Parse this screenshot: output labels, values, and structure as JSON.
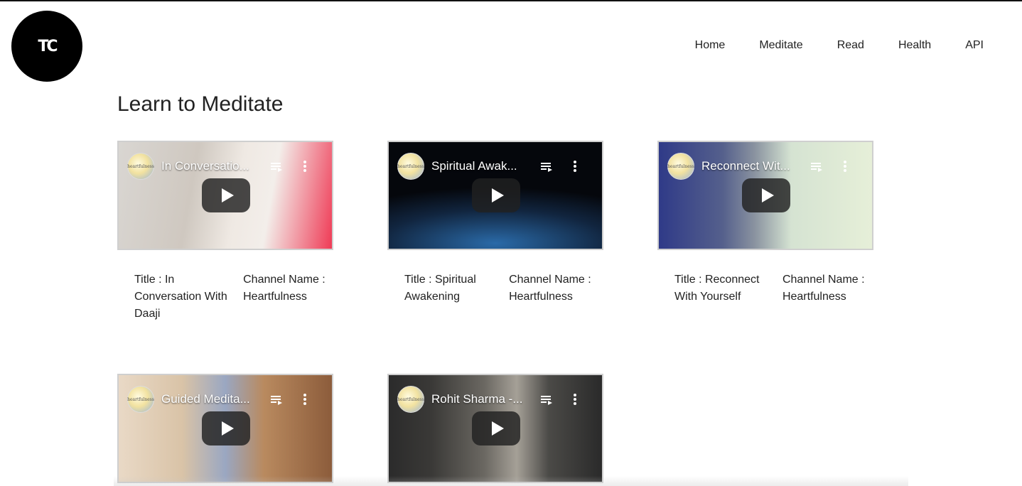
{
  "logo": {
    "text": "TC"
  },
  "nav": {
    "items": [
      "Home",
      "Meditate",
      "Read",
      "Health",
      "API"
    ]
  },
  "page": {
    "title": "Learn to Meditate"
  },
  "videos": [
    {
      "overlay_title": "In Conversatio...",
      "title_text": "Title : In Conversation With Daaji",
      "channel_text": "Channel Name : Heartfulness",
      "channel_logo": "heartfulness",
      "thumb_colors": [
        "#d9d6d2",
        "#e8e4e0",
        "#ef3b56"
      ]
    },
    {
      "overlay_title": "Spiritual Awak...",
      "title_text": "Title : Spiritual Awakening",
      "channel_text": "Channel Name : Heartfulness",
      "channel_logo": "heartfulness",
      "thumb_colors": [
        "#05070c",
        "#11253f",
        "#2a6aa8"
      ]
    },
    {
      "overlay_title": "Reconnect Wit...",
      "title_text": "Title : Reconnect With Yourself",
      "channel_text": "Channel Name : Heartfulness",
      "channel_logo": "heartfulness",
      "thumb_colors": [
        "#2f3a88",
        "#6b7a9a",
        "#e6efd8"
      ]
    },
    {
      "overlay_title": "Guided Medita...",
      "title_text": "",
      "channel_text": "",
      "channel_logo": "heartfulness",
      "thumb_colors": [
        "#8c5c3b",
        "#c9a27c",
        "#e9d9c6"
      ]
    },
    {
      "overlay_title": "Rohit Sharma -...",
      "title_text": "",
      "channel_text": "",
      "channel_logo": "heartfulness",
      "thumb_colors": [
        "#2b2b2b",
        "#6b6862",
        "#a5a097"
      ]
    }
  ],
  "colors": {
    "page_bg": "#ffffff",
    "text": "#222222",
    "logo_bg": "#000000"
  }
}
